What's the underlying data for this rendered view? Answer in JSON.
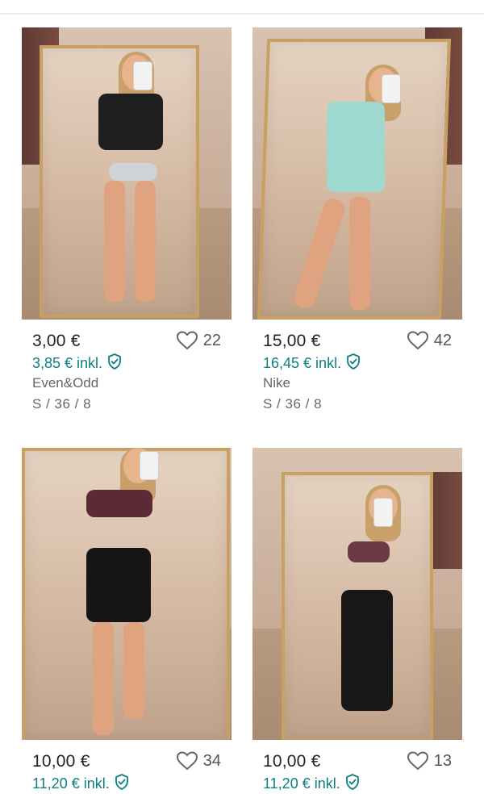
{
  "items": [
    {
      "price": "3,00 €",
      "price_incl": "3,85 € inkl.",
      "favorites": "22",
      "brand": "Even&Odd",
      "size": "S / 36 / 8",
      "top_color": "#1e1e1e",
      "bottom_color": "#cfd3d6"
    },
    {
      "price": "15,00 €",
      "price_incl": "16,45 € inkl.",
      "favorites": "42",
      "brand": "Nike",
      "size": "S / 36 / 8",
      "top_color": "#9fd8cf",
      "bottom_color": "#9fd8cf"
    },
    {
      "price": "10,00 €",
      "price_incl": "11,20 € inkl.",
      "favorites": "34",
      "brand": "",
      "size": "",
      "top_color": "#5a2a36",
      "bottom_color": "#151515"
    },
    {
      "price": "10,00 €",
      "price_incl": "11,20 € inkl.",
      "favorites": "13",
      "brand": "",
      "size": "",
      "top_color": "#6b3a46",
      "bottom_color": "#171717"
    }
  ],
  "icons": {
    "favorite": "heart-outline-icon",
    "buyer_protection": "shield-check-icon"
  },
  "colors": {
    "accent": "#0a7f82",
    "text": "#222222",
    "muted": "#666666"
  }
}
